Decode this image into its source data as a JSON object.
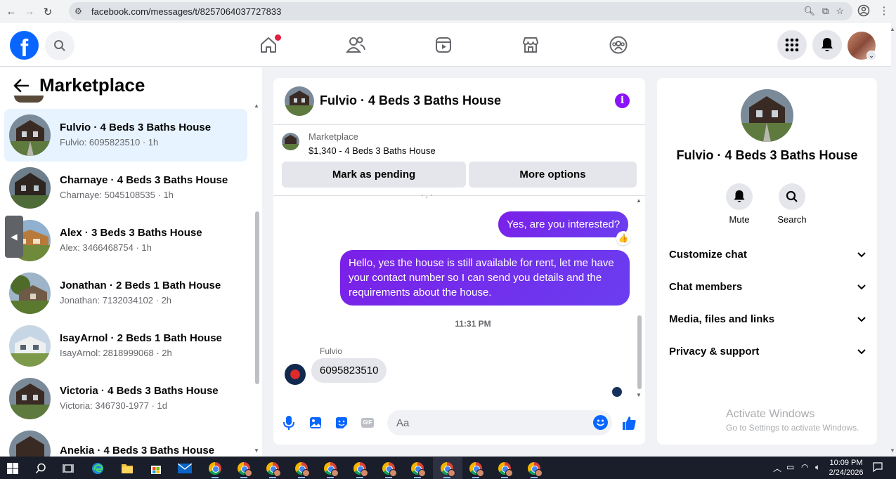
{
  "browser": {
    "url": "facebook.com/messages/t/8257064037727833"
  },
  "sidebar": {
    "title": "Marketplace",
    "conversations": [
      {
        "name": "Fulvio · 4 Beds 3 Baths House",
        "sub": "Fulvio: 6095823510 · 1h",
        "active": true
      },
      {
        "name": "Charnaye · 4 Beds 3 Baths House",
        "sub": "Charnaye: 5045108535 · 1h"
      },
      {
        "name": "Alex · 3 Beds 3 Baths House",
        "sub": "Alex: 3466468754 · 1h"
      },
      {
        "name": "Jonathan · 2 Beds 1 Bath House",
        "sub": "Jonathan: 7132034102 · 2h"
      },
      {
        "name": "IsayArnol · 2 Beds 1 Bath House",
        "sub": "IsayArnol: 2818999068 · 2h"
      },
      {
        "name": "Victoria · 4 Beds 3 Baths House",
        "sub": "Victoria: 346730-1977 · 1d"
      },
      {
        "name": "Anekia · 4 Beds 3 Baths House",
        "sub": ""
      }
    ]
  },
  "chat": {
    "title": "Fulvio · 4 Beds 3 Baths House",
    "listing_label": "Marketplace",
    "listing_title": "$1,340 - 4 Beds 3 Baths House",
    "mark_pending": "Mark as pending",
    "more_options": "More options",
    "messages": {
      "out_1": "Yes, are you interested?",
      "out_1_reaction": "👍",
      "out_2": "Hello, yes the house is still available for rent, let me have your contact number so I can send you details and the requirements about the house.",
      "time": "11:31 PM",
      "sender": "Fulvio",
      "in_1": "6095823510"
    },
    "composer_placeholder": "Aa",
    "gif_label": "GIF"
  },
  "info_panel": {
    "name": "Fulvio · 4 Beds 3 Baths House",
    "mute": "Mute",
    "search": "Search",
    "rows": [
      "Customize chat",
      "Chat members",
      "Media, files and links",
      "Privacy & support"
    ],
    "activate_title": "Activate Windows",
    "activate_sub": "Go to Settings to activate Windows."
  },
  "taskbar": {
    "time": "10:09 PM",
    "date": "2/24/2026"
  },
  "colors": {
    "fb_blue": "#0866ff",
    "messenger_purple": "#7b1fe8",
    "active_conv": "#e7f3ff"
  }
}
